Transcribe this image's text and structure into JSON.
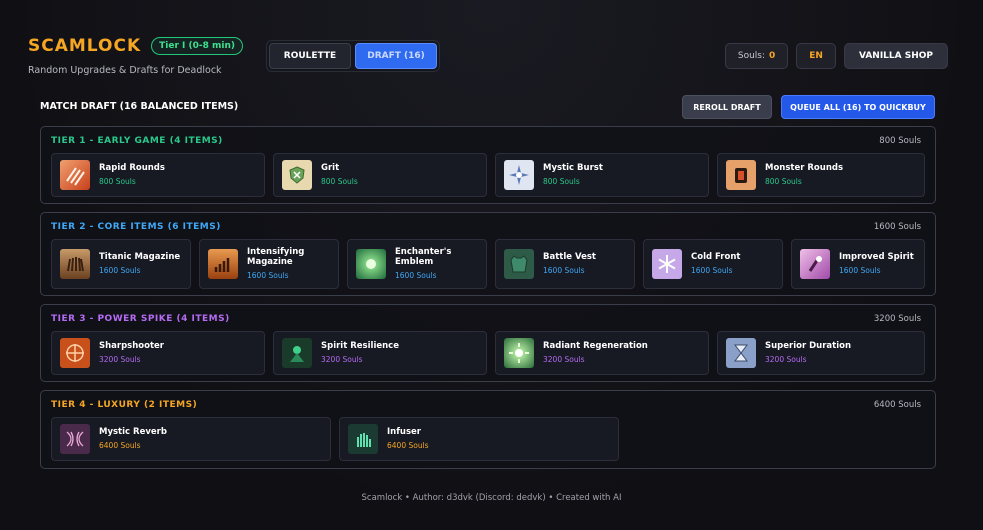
{
  "brand": {
    "name": "SCAMLOCK",
    "tier_badge": "Tier I (0-8 min)",
    "subtitle": "Random Upgrades & Drafts for Deadlock"
  },
  "modes": {
    "roulette": "ROULETTE",
    "draft": "DRAFT (16)",
    "active": "draft"
  },
  "top_right": {
    "souls_label": "Souls:",
    "souls_value": "0",
    "language": "EN",
    "vanilla_shop": "VANILLA SHOP"
  },
  "draft": {
    "title": "MATCH DRAFT (16 BALANCED ITEMS)",
    "reroll_label": "REROLL DRAFT",
    "queue_label": "QUEUE ALL (16) TO QUICKBUY"
  },
  "tiers": [
    {
      "title": "TIER 1 - EARLY GAME (4 ITEMS)",
      "cost": "800 Souls",
      "color": "#29c98a",
      "items": [
        {
          "name": "Rapid Rounds",
          "price": "800 Souls",
          "icon": "rapid-rounds-icon"
        },
        {
          "name": "Grit",
          "price": "800 Souls",
          "icon": "grit-icon"
        },
        {
          "name": "Mystic Burst",
          "price": "800 Souls",
          "icon": "mystic-burst-icon"
        },
        {
          "name": "Monster Rounds",
          "price": "800 Souls",
          "icon": "monster-rounds-icon"
        }
      ]
    },
    {
      "title": "TIER 2 - CORE ITEMS (6 ITEMS)",
      "cost": "1600 Souls",
      "color": "#3fa9f5",
      "items": [
        {
          "name": "Titanic Magazine",
          "price": "1600 Souls",
          "icon": "titanic-magazine-icon"
        },
        {
          "name": "Intensifying Magazine",
          "price": "1600 Souls",
          "icon": "intensifying-magazine-icon"
        },
        {
          "name": "Enchanter's Emblem",
          "price": "1600 Souls",
          "icon": "enchanters-emblem-icon"
        },
        {
          "name": "Battle Vest",
          "price": "1600 Souls",
          "icon": "battle-vest-icon"
        },
        {
          "name": "Cold Front",
          "price": "1600 Souls",
          "icon": "cold-front-icon"
        },
        {
          "name": "Improved Spirit",
          "price": "1600 Souls",
          "icon": "improved-spirit-icon"
        }
      ]
    },
    {
      "title": "TIER 3 - POWER SPIKE (4 ITEMS)",
      "cost": "3200 Souls",
      "color": "#b46cf2",
      "items": [
        {
          "name": "Sharpshooter",
          "price": "3200 Souls",
          "icon": "sharpshooter-icon"
        },
        {
          "name": "Spirit Resilience",
          "price": "3200 Souls",
          "icon": "spirit-resilience-icon"
        },
        {
          "name": "Radiant Regeneration",
          "price": "3200 Souls",
          "icon": "radiant-regeneration-icon"
        },
        {
          "name": "Superior Duration",
          "price": "3200 Souls",
          "icon": "superior-duration-icon"
        }
      ]
    },
    {
      "title": "TIER 4 - LUXURY (2 ITEMS)",
      "cost": "6400 Souls",
      "color": "#f5a623",
      "items": [
        {
          "name": "Mystic Reverb",
          "price": "6400 Souls",
          "icon": "mystic-reverb-icon"
        },
        {
          "name": "Infuser",
          "price": "6400 Souls",
          "icon": "infuser-icon"
        }
      ]
    }
  ],
  "footer": "Scamlock • Author: d3dvk (Discord: dedvk) • Created with AI"
}
